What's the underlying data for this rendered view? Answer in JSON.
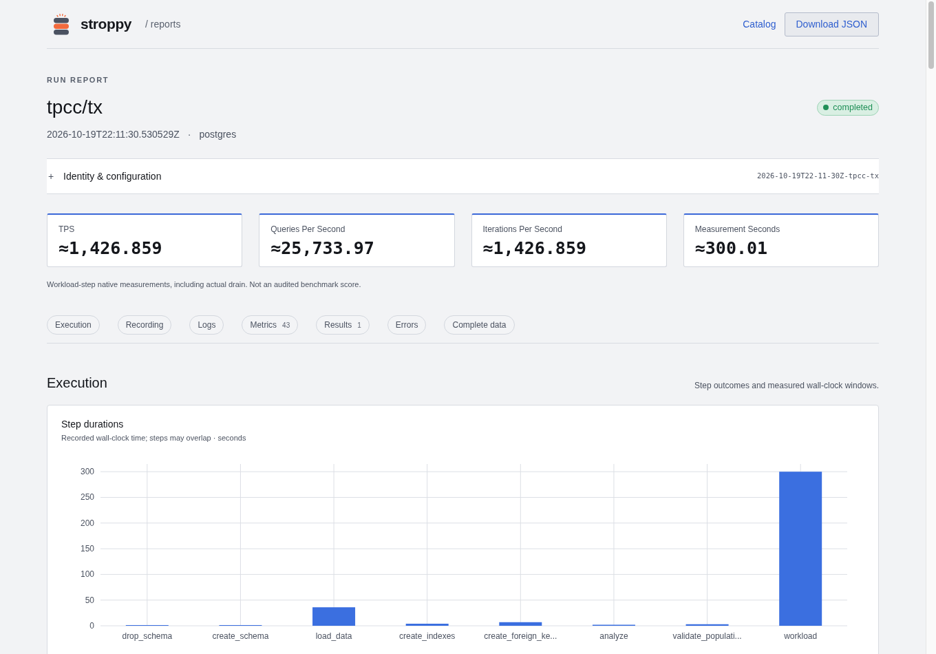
{
  "header": {
    "brand": "stroppy",
    "breadcrumb": "/ reports",
    "actions": [
      {
        "label": "Catalog",
        "kind": "link"
      },
      {
        "label": "Download JSON",
        "kind": "button"
      }
    ]
  },
  "report": {
    "eyebrow": "RUN REPORT",
    "title": "tpcc/tx",
    "status": {
      "label": "completed",
      "kind": "success"
    },
    "meta": {
      "timestamp": "2026-10-19T22:11:30.530529Z",
      "separator": "·",
      "engine": "postgres"
    }
  },
  "identity_panel": {
    "toggle_glyph": "+",
    "label": "Identity & configuration",
    "run_id": "2026-10-19T22-11-30Z-tpcc-tx"
  },
  "metrics": [
    {
      "label": "TPS",
      "value": "≈1,426.859"
    },
    {
      "label": "Queries Per Second",
      "value": "≈25,733.97"
    },
    {
      "label": "Iterations Per Second",
      "value": "≈1,426.859"
    },
    {
      "label": "Measurement Seconds",
      "value": "≈300.01"
    }
  ],
  "metrics_note": "Workload-step native measurements, including actual drain. Not an audited benchmark score.",
  "tabs": [
    {
      "label": "Execution"
    },
    {
      "label": "Recording"
    },
    {
      "label": "Logs"
    },
    {
      "label": "Metrics",
      "count": "43"
    },
    {
      "label": "Results",
      "count": "1"
    },
    {
      "label": "Errors"
    },
    {
      "label": "Complete data"
    }
  ],
  "execution": {
    "heading": "Execution",
    "description": "Step outcomes and measured wall-clock windows.",
    "card": {
      "subtitle": "Recorded wall-clock time; steps may overlap · seconds",
      "chart_data": {
        "type": "bar",
        "title": "Step durations",
        "categories": [
          "drop_schema",
          "create_schema",
          "load_data",
          "create_indexes",
          "create_foreign_ke...",
          "analyze",
          "validate_populati...",
          "workload"
        ],
        "values": [
          1,
          1,
          36,
          4,
          7,
          2,
          3,
          300
        ],
        "ylim": [
          0,
          315
        ],
        "yticks": [
          0,
          50,
          100,
          150,
          200,
          250,
          300
        ],
        "grid": true
      }
    }
  }
}
